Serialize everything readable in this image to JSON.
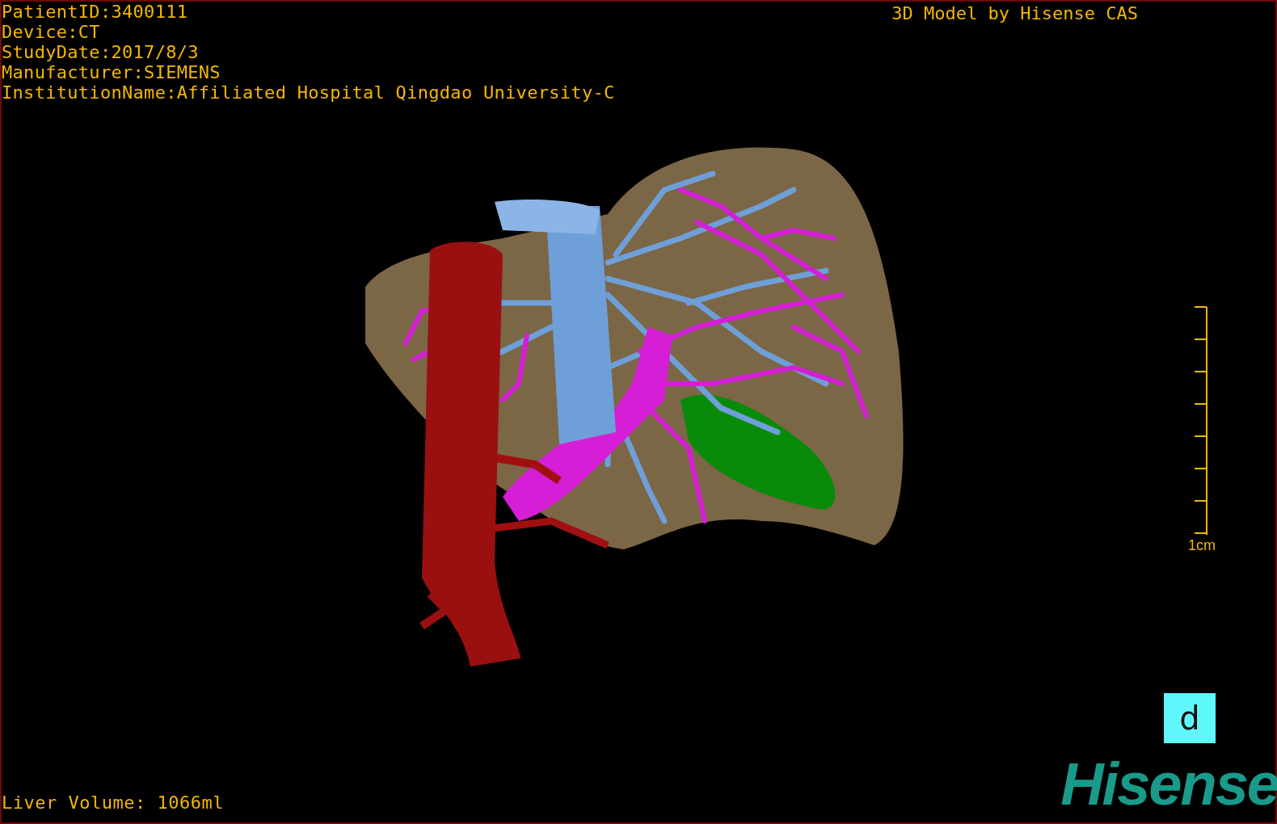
{
  "patient_info": [
    "PatientID:3400111",
    "Device:CT",
    "StudyDate:2017/8/3",
    "Manufacturer:SIEMENS",
    "InstitutionName:Affiliated Hospital Qingdao University-C"
  ],
  "title": "3D Model by Hisense CAS",
  "scale_bar": {
    "label": "1cm"
  },
  "liver_volume": "Liver Volume: 1066ml",
  "view_button": {
    "label": "d"
  },
  "logo": "Hisense"
}
